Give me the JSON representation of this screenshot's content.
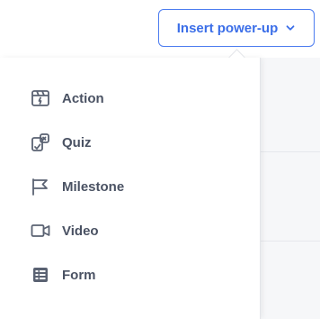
{
  "header": {
    "insert_button_label": "Insert power-up"
  },
  "menu": {
    "items": [
      {
        "label": "Action",
        "icon": "action-icon"
      },
      {
        "label": "Quiz",
        "icon": "quiz-icon"
      },
      {
        "label": "Milestone",
        "icon": "milestone-flag-icon"
      },
      {
        "label": "Video",
        "icon": "video-camera-icon"
      },
      {
        "label": "Form",
        "icon": "form-icon"
      }
    ]
  },
  "colors": {
    "accent": "#3b6ee8",
    "item_text": "#4a5263",
    "icon": "#5a6272"
  }
}
